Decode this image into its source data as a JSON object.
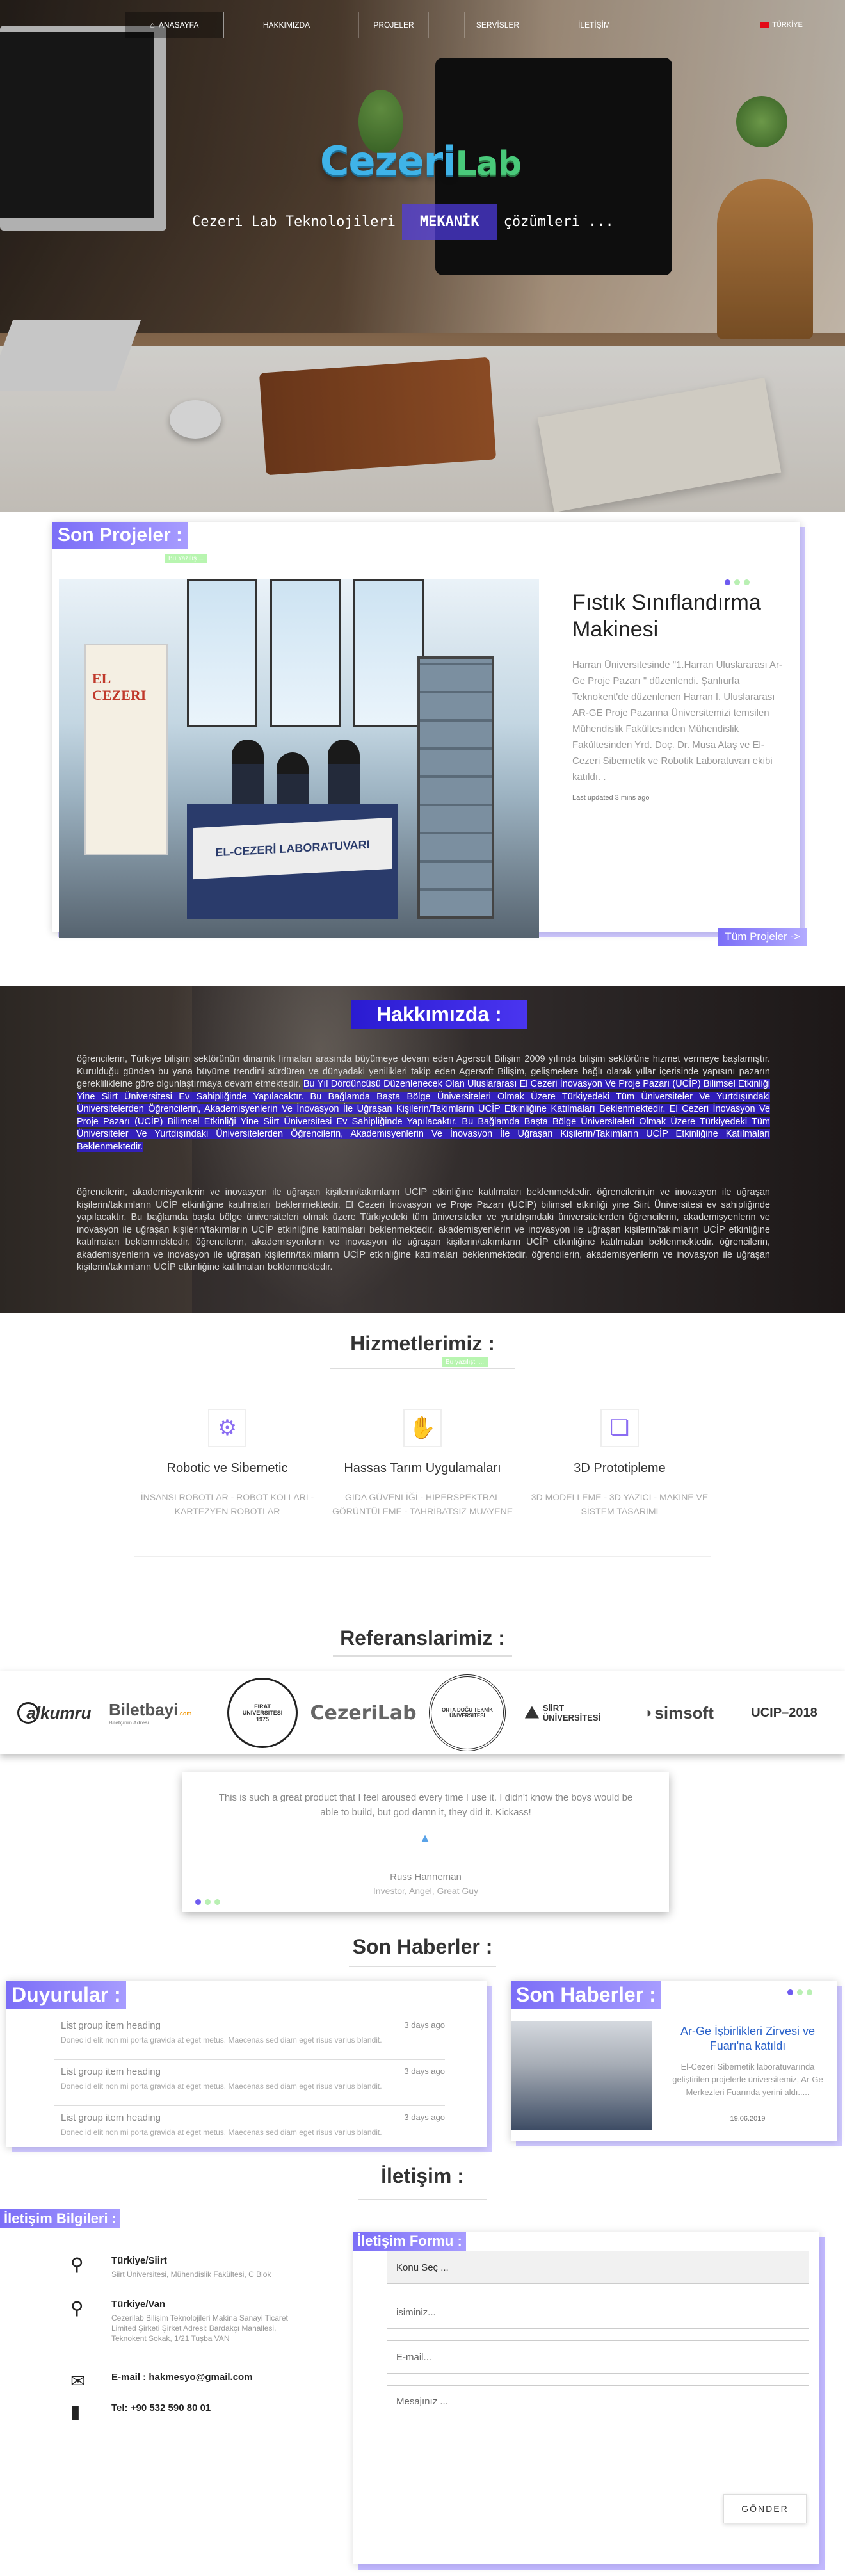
{
  "nav": {
    "home": "ANASAYFA",
    "about": "HAKKIMIZDA",
    "projects": "PROJELER",
    "services": "SERVİSLER",
    "contact": "İLETİŞİM",
    "lang": "TÜRKİYE"
  },
  "hero": {
    "logo_main": "Cezeri",
    "logo_lab": "Lab",
    "tagline_pre": "Cezeri Lab Teknolojileri",
    "tagline_hl": "MEKANİK",
    "tagline_post": "çözümleri ..."
  },
  "projects": {
    "title": "Son Projeler :",
    "badge": "Bu Yazılış ...",
    "item_title": "Fıstık Sınıflandırma Makinesi",
    "item_desc": "Harran Üniversitesinde \"1.Harran Uluslararası Ar-Ge Proje Pazarı \" düzenlendi. Şanlıurfa Teknokent'de düzenlenen Harran I. Uluslararası AR-GE Proje Pazanna Üniversitemizi temsilen Mühendislik Fakültesinden Mühendislik Fakültesinden Yrd. Doç. Dr. Musa Ataş ve El-Cezeri Sibernetik ve Robotik Laboratuvarı ekibi katıldı. .",
    "updated": "Last updated 3 mins ago",
    "all_button": "Tüm Projeler ->",
    "poster_text": "EL CEZERI",
    "banner_text": "EL-CEZERİ LABORATUVARI"
  },
  "about": {
    "title": "Hakkımızda :",
    "p1_a": "öğrencilerin, Türkiye bilişim sektörünün dinamik firmaları arasında büyümeye devam eden Agersoft Bilişim 2009 yılında bilişim sektörüne hizmet vermeye başlamıştır. Kurulduğu günden bu yana büyüme trendini sürdüren ve dünyadaki yenilikleri takip eden Agersoft Bilişim, gelişmelere bağlı olarak yıllar içerisinde yapısını pazarın gereklilikleine göre olgunlaştırmaya devam etmektedir.",
    "p1_hl": "Bu Yıl Dördüncüsü Düzenlenecek Olan Uluslararası El Cezeri İnovasyon Ve Proje Pazarı (UCİP) Bilimsel Etkinliği Yine Siirt Üniversitesi Ev Sahipliğinde Yapılacaktır. Bu Bağlamda Başta Bölge Üniversiteleri Olmak Üzere Türkiyedeki Tüm Üniversiteler Ve Yurtdışındaki Üniversitelerden Öğrencilerin, Akademisyenlerin Ve İnovasyon İle Uğraşan Kişilerin/Takımların UCİP Etkinliğine Katılmaları Beklenmektedir. El Cezeri İnovasyon Ve Proje Pazarı (UCİP) Bilimsel Etkinliği Yine Siirt Üniversitesi Ev Sahipliğinde Yapılacaktır. Bu Bağlamda Başta Bölge Üniversiteleri Olmak Üzere Türkiyedeki Tüm Üniversiteler Ve Yurtdışındaki Üniversitelerden Öğrencilerin, Akademisyenlerin Ve İnovasyon İle Uğraşan Kişilerin/Takımların UCİP Etkinliğine Katılmaları Beklenmektedir.",
    "p2": "öğrencilerin, akademisyenlerin ve inovasyon ile uğraşan kişilerin/takımların UCİP etkinliğine katılmaları beklenmektedir. öğrencilerin,in ve inovasyon ile uğraşan kişilerin/takımların UCİP etkinliğine katılmaları beklenmektedir. El Cezeri İnovasyon ve Proje Pazarı (UCİP) bilimsel etkinliği yine Siirt Üniversitesi ev sahipliğinde yapılacaktır. Bu bağlamda başta bölge üniversiteleri olmak üzere Türkiyedeki tüm üniversiteler ve yurtdışındaki üniversitelerden öğrencilerin, akademisyenlerin ve inovasyon ile uğraşan kişilerin/takımların UCİP etkinliğine katılmaları beklenmektedir. akademisyenlerin ve inovasyon ile uğraşan kişilerin/takımların UCİP etkinliğine katılmaları beklenmektedir. öğrencilerin, akademisyenlerin ve inovasyon ile uğraşan kişilerin/takımların UCİP etkinliğine katılmaları beklenmektedir. öğrencilerin, akademisyenlerin ve inovasyon ile uğraşan kişilerin/takımların UCİP etkinliğine katılmaları beklenmektedir. öğrencilerin, akademisyenlerin ve inovasyon ile uğraşan kişilerin/takımların UCİP etkinliğine katılmaları beklenmektedir."
  },
  "services": {
    "title": "Hizmetlerimiz :",
    "badge": "Bu yazılıştı ...",
    "items": [
      {
        "title": "Robotic ve Sibernetic",
        "desc": "İNSANSI ROBOTLAR - ROBOT KOLLARI - KARTEZYEN ROBOTLAR",
        "icon": "robot-arm-icon"
      },
      {
        "title": "Hassas Tarım Uygulamaları",
        "desc": "GIDA GÜVENLİĞİ - HİPERSPEKTRAL GÖRÜNTÜLEME - TAHRİBATSIZ MUAYENE",
        "icon": "hand-scan-icon"
      },
      {
        "title": "3D Prototipleme",
        "desc": "3D MODELLEME - 3D YAZICI - MAKİNE VE SİSTEM TASARIMI",
        "icon": "layers-icon"
      }
    ]
  },
  "references": {
    "title": "Referanslarimiz :",
    "logos": [
      "alkumru",
      "Biletbayi",
      "FIRAT ÜNİVERSİTESİ 1975",
      "CezeriLab",
      "ORTA DOĞU TEKNİK ÜNİVERSİTESİ",
      "SİİRT ÜNİVERSİTESİ",
      "simsoft",
      "UCIP–2018"
    ],
    "biletbayi_sub": ".com",
    "biletbayi_tag": "Biletçinin Adresi"
  },
  "testimonial": {
    "quote": "This is such a great product that I feel aroused every time I use it. I didn't know the boys would be able to build, but god damn it, they did it. Kickass!",
    "name": "Russ Hanneman",
    "role": "Investor, Angel, Great Guy"
  },
  "news_heading": "Son Haberler :",
  "announcements": {
    "title": "Duyurular :",
    "items": [
      {
        "heading": "List group item heading",
        "date": "3 days ago",
        "body": "Donec id elit non mi porta gravida at eget metus. Maecenas sed diam eget risus varius blandit."
      },
      {
        "heading": "List group item heading",
        "date": "3 days ago",
        "body": "Donec id elit non mi porta gravida at eget metus. Maecenas sed diam eget risus varius blandit."
      },
      {
        "heading": "List group item heading",
        "date": "3 days ago",
        "body": "Donec id elit non mi porta gravida at eget metus. Maecenas sed diam eget risus varius blandit."
      }
    ]
  },
  "news": {
    "title": "Son Haberler :",
    "item_title": "Ar-Ge İşbirlikleri Zirvesi ve Fuarı'na katıldı",
    "item_desc": "El-Cezeri Sibernetik laboratuvarında geliştirilen projelerle üniversitemiz, Ar-Ge Merkezleri Fuarında yerini aldı.....",
    "item_date": "19.06.2019"
  },
  "contact": {
    "title": "İletişim :",
    "info_title": "İletişim Bilgileri :",
    "siirt_t": "Türkiye/Siirt",
    "siirt_s": "Siirt Üniversitesi, Mühendislik Fakültesi, C Blok",
    "van_t": "Türkiye/Van",
    "van_s": "Cezerilab Bilişim Teknolojileri Makina Sanayi Ticaret Limited Şirketi Şirket Adresi: Bardakçı Mahallesi, Teknokent Sokak, 1/21 Tuşba VAN",
    "email": "E-mail : hakmesyo@gmail.com",
    "tel": "Tel: +90 532 590 80 01",
    "form_title": "İletişim Formu :",
    "select": "Konu Seç ...",
    "name_ph": "isiminiz...",
    "email_ph": "E-mail...",
    "msg_ph": "Mesajınız ...",
    "send": "GÖNDER"
  },
  "colors": {
    "accent": "#7b6ef7",
    "dot_active": "#6e5bf0",
    "dot": "#b9f0b3",
    "link": "#2860c9"
  }
}
